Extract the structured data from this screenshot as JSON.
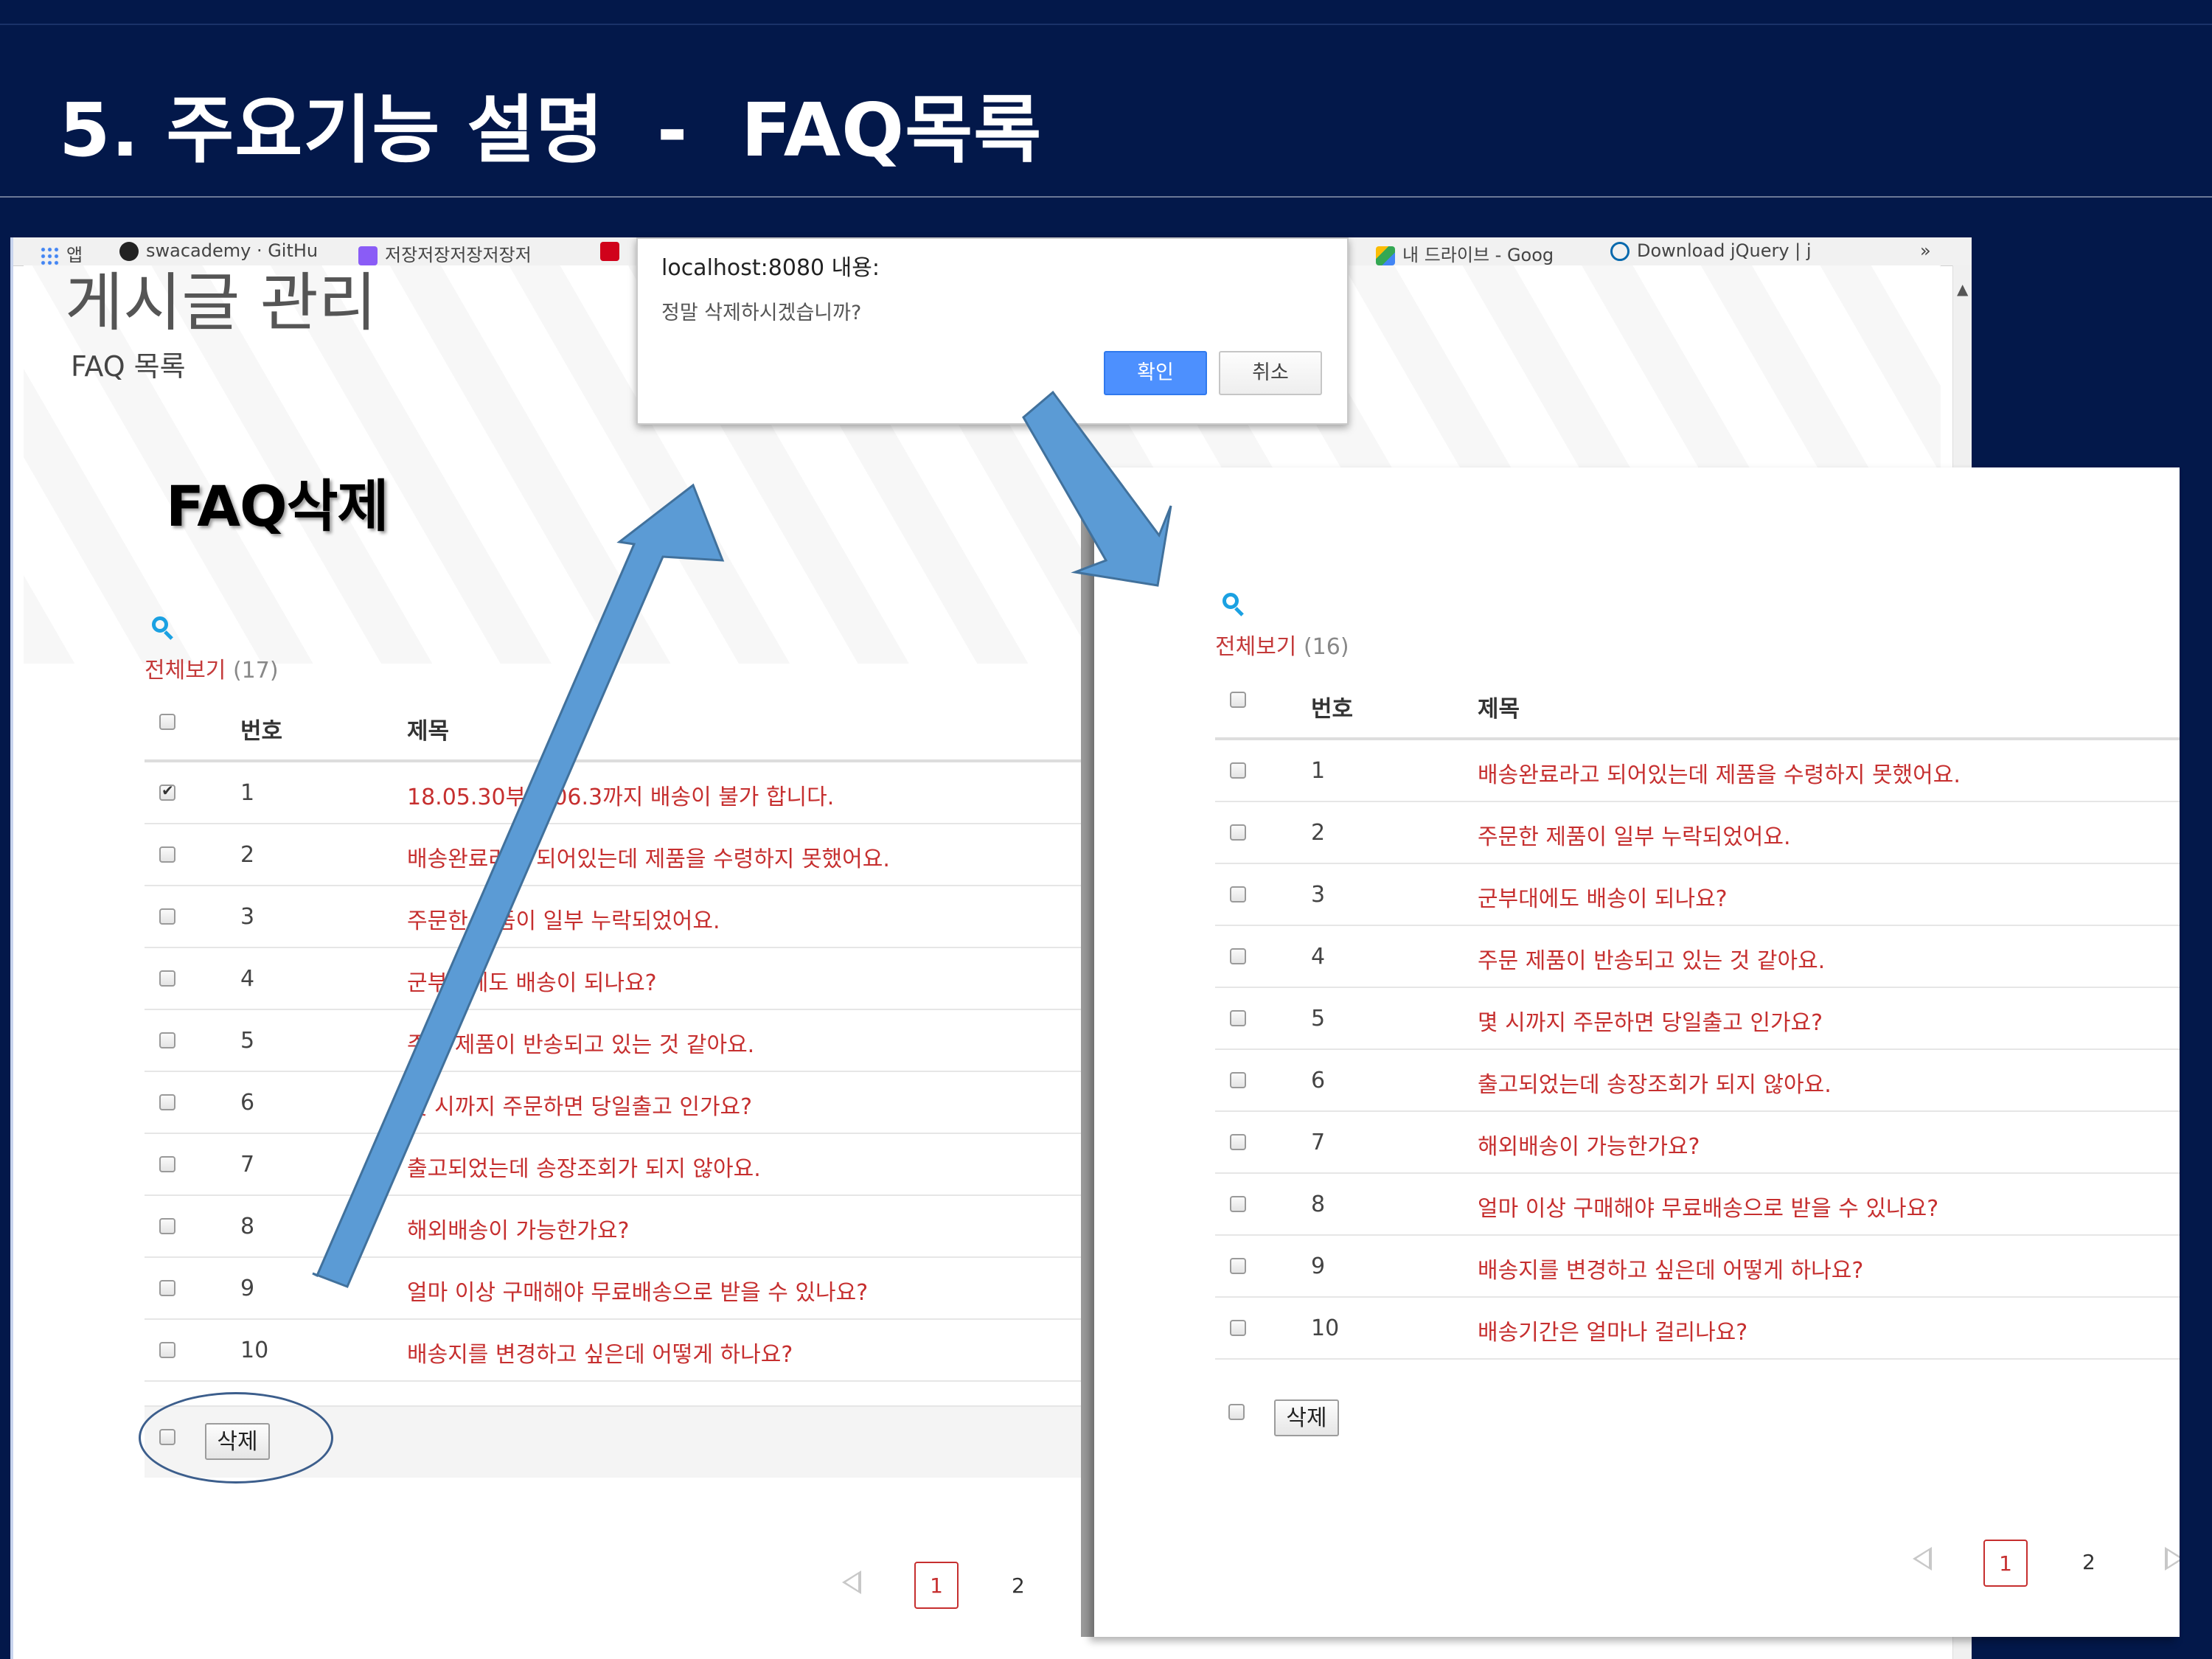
{
  "slide": {
    "title": "5. 주요기능 설명  -  FAQ목록"
  },
  "browser": {
    "bookmarks": [
      {
        "label": "앱",
        "icon": "apps-grid-icon"
      },
      {
        "label": "swacademy · GitHu",
        "icon": "github-icon"
      },
      {
        "label": "저장저장저장저장저",
        "icon": "bookmark-d-icon"
      },
      {
        "label": "내 드라이브 - Goog",
        "icon": "google-drive-icon"
      },
      {
        "label": "Download jQuery | j",
        "icon": "jquery-icon"
      },
      {
        "label": "»",
        "icon": "more-chevron-icon"
      }
    ],
    "page_heading": "게시글 관리",
    "page_subheading": "FAQ 목록"
  },
  "annotation": {
    "faq_delete_label": "FAQ삭제"
  },
  "dialog": {
    "title": "localhost:8080 내용:",
    "message": "정말 삭제하시겠습니까?",
    "ok_label": "확인",
    "cancel_label": "취소"
  },
  "left_list": {
    "all_label": "전체보기",
    "count": "(17)",
    "col_no": "번호",
    "col_title": "제목",
    "delete_label": "삭제",
    "pages": [
      "1",
      "2"
    ],
    "rows": [
      {
        "no": "1",
        "title": "18.05.30부터 06.3까지 배송이 불가 합니다.",
        "checked": true
      },
      {
        "no": "2",
        "title": "배송완료라고 되어있는데 제품을 수령하지 못했어요.",
        "checked": false
      },
      {
        "no": "3",
        "title": "주문한 제품이 일부 누락되었어요.",
        "checked": false
      },
      {
        "no": "4",
        "title": "군부대에도 배송이 되나요?",
        "checked": false
      },
      {
        "no": "5",
        "title": "주문 제품이 반송되고 있는 것 같아요.",
        "checked": false
      },
      {
        "no": "6",
        "title": "몇 시까지 주문하면 당일출고 인가요?",
        "checked": false
      },
      {
        "no": "7",
        "title": "출고되었는데 송장조회가 되지 않아요.",
        "checked": false
      },
      {
        "no": "8",
        "title": "해외배송이 가능한가요?",
        "checked": false
      },
      {
        "no": "9",
        "title": "얼마 이상 구매해야 무료배송으로 받을 수 있나요?",
        "checked": false
      },
      {
        "no": "10",
        "title": "배송지를 변경하고 싶은데 어떻게 하나요?",
        "checked": false
      }
    ]
  },
  "right_list": {
    "all_label": "전체보기",
    "count": "(16)",
    "col_no": "번호",
    "col_title": "제목",
    "delete_label": "삭제",
    "pages": [
      "1",
      "2"
    ],
    "rows": [
      {
        "no": "1",
        "title": "배송완료라고 되어있는데 제품을 수령하지 못했어요."
      },
      {
        "no": "2",
        "title": "주문한 제품이 일부 누락되었어요."
      },
      {
        "no": "3",
        "title": "군부대에도 배송이 되나요?"
      },
      {
        "no": "4",
        "title": "주문 제품이 반송되고 있는 것 같아요."
      },
      {
        "no": "5",
        "title": "몇 시까지 주문하면 당일출고 인가요?"
      },
      {
        "no": "6",
        "title": "출고되었는데 송장조회가 되지 않아요."
      },
      {
        "no": "7",
        "title": "해외배송이 가능한가요?"
      },
      {
        "no": "8",
        "title": "얼마 이상 구매해야 무료배송으로 받을 수 있나요?"
      },
      {
        "no": "9",
        "title": "배송지를 변경하고 싶은데 어떻게 하나요?"
      },
      {
        "no": "10",
        "title": "배송기간은 얼마나 걸리나요?"
      }
    ]
  },
  "colors": {
    "slide_bg": "#03184a",
    "link_red": "#c62f2f",
    "dialog_ok": "#4d90fe",
    "arrow_blue": "#5b9bd5"
  }
}
